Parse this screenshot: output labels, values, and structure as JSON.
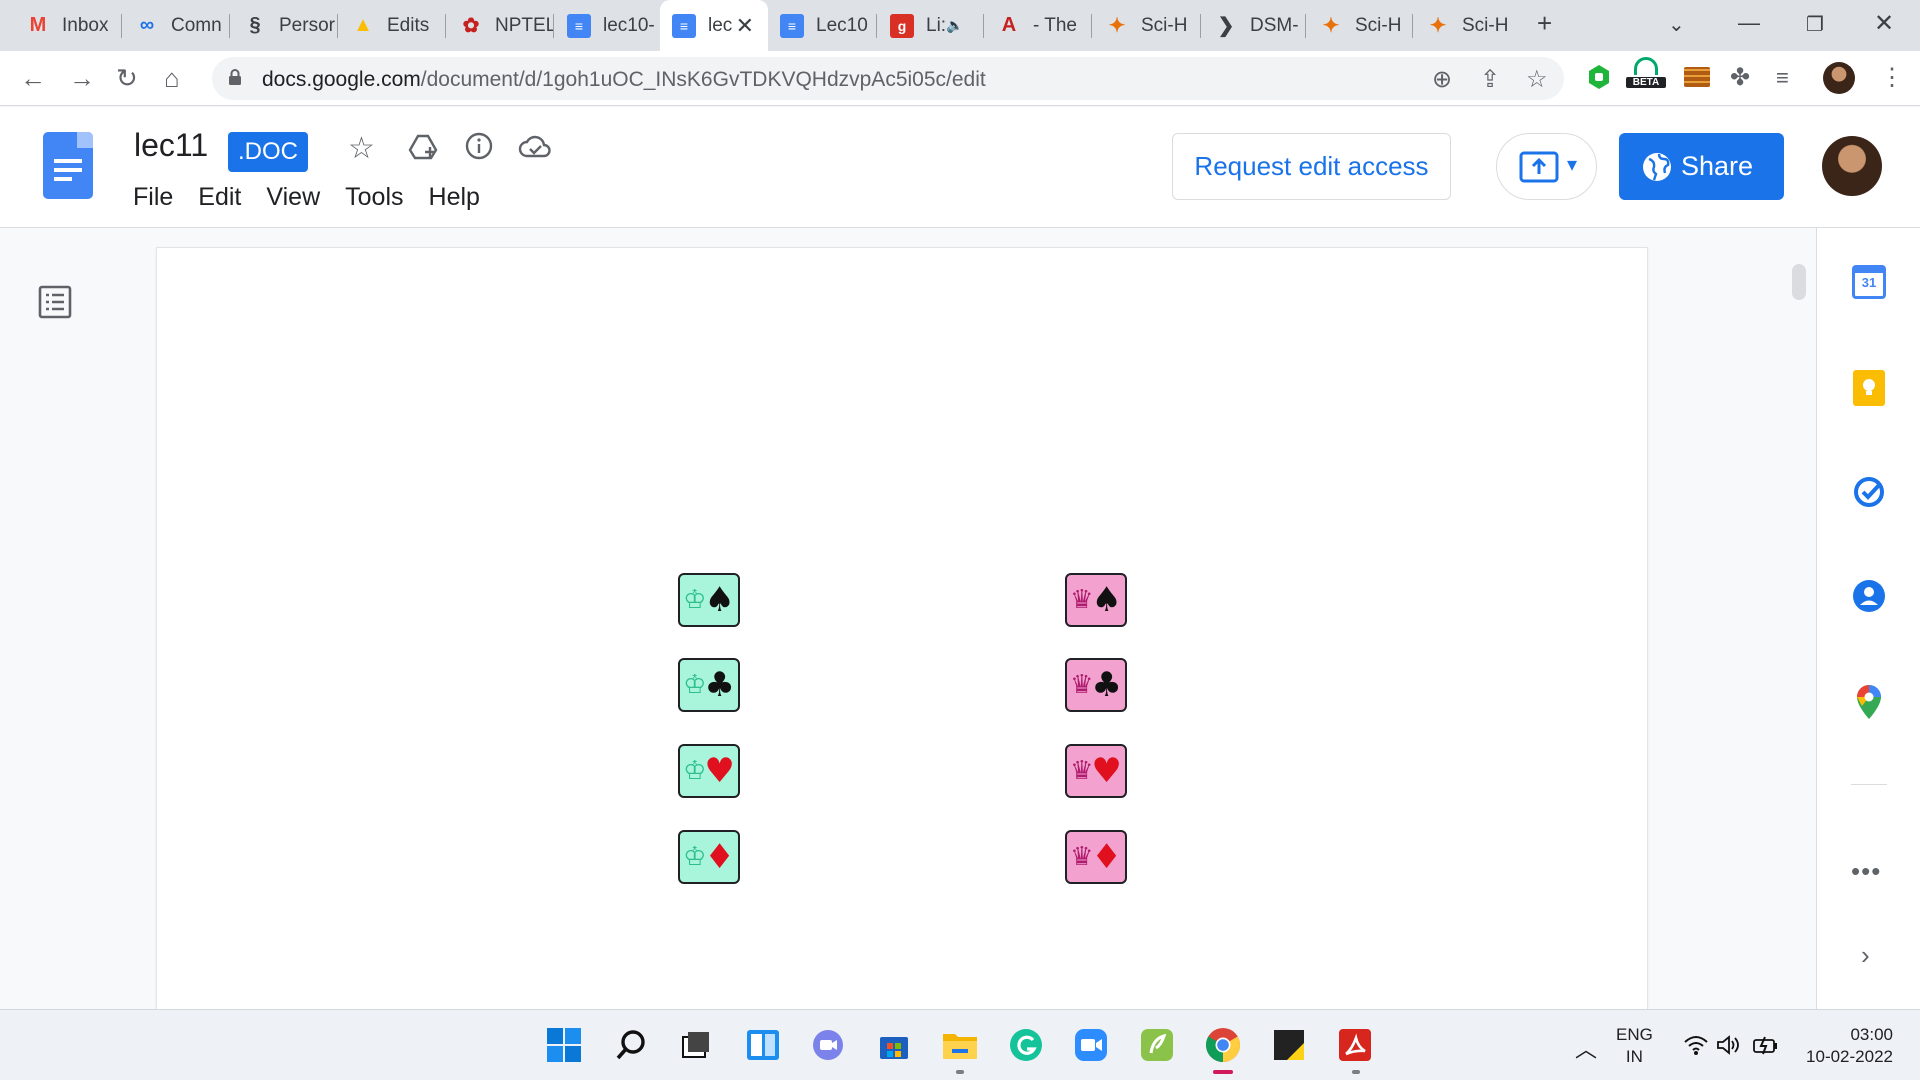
{
  "browser": {
    "tabs": [
      {
        "title": "Inbox",
        "icon": "gmail-icon",
        "color": "#ea4335"
      },
      {
        "title": "Comn",
        "icon": "link-icon",
        "color": "#1a73e8"
      },
      {
        "title": "Persor",
        "icon": "dna-icon",
        "color": "#3c4043"
      },
      {
        "title": "Edits",
        "icon": "google-drive-icon",
        "color": "#fbbc04"
      },
      {
        "title": "NPTEL",
        "icon": "nptel-icon",
        "color": "#c5221f"
      },
      {
        "title": "lec10-",
        "icon": "google-docs-icon",
        "color": "#4285f4"
      },
      {
        "title": "lec",
        "icon": "google-docs-icon",
        "color": "#4285f4"
      },
      {
        "title": "Lec10",
        "icon": "google-docs-icon",
        "color": "#4285f4"
      },
      {
        "title": "Li:",
        "icon": "g-letter-icon",
        "color": "#d93025"
      },
      {
        "title": "- The",
        "icon": "a-letter-icon",
        "color": "#c5221f"
      },
      {
        "title": "Sci-H",
        "icon": "raven-icon",
        "color": "#e8710a"
      },
      {
        "title": "DSM-",
        "icon": "arrow-icon",
        "color": "#3c4043"
      },
      {
        "title": "Sci-H",
        "icon": "raven-icon",
        "color": "#e8710a"
      },
      {
        "title": "Sci-H",
        "icon": "raven-icon",
        "color": "#e8710a"
      }
    ],
    "active_tab_index": 6,
    "new_tab": "+",
    "url_host": "docs.google.com",
    "url_path": "/document/d/1goh1uOC_INsK6GvTDKVQHdzvpAc5i05c/edit",
    "beta_label": "BETA"
  },
  "docs": {
    "title": "lec11",
    "badge": ".DOC",
    "menus": [
      "File",
      "Edit",
      "View",
      "Tools",
      "Help"
    ],
    "request_edit": "Request edit access",
    "share": "Share"
  },
  "cards": {
    "king_rank": "♔",
    "queen_rank": "♛",
    "suits": [
      {
        "glyph": "♠",
        "color": "black"
      },
      {
        "glyph": "♣",
        "color": "black"
      },
      {
        "glyph": "♥",
        "color": "red"
      },
      {
        "glyph": "♦",
        "color": "red"
      }
    ],
    "king_color": "#a8f5dc",
    "queen_color": "#f3a2d0"
  },
  "sidepanel": {
    "calendar_day": "31",
    "more": "•••"
  },
  "system": {
    "lang_line1": "ENG",
    "lang_line2": "IN",
    "time": "03:00",
    "date": "10-02-2022"
  }
}
